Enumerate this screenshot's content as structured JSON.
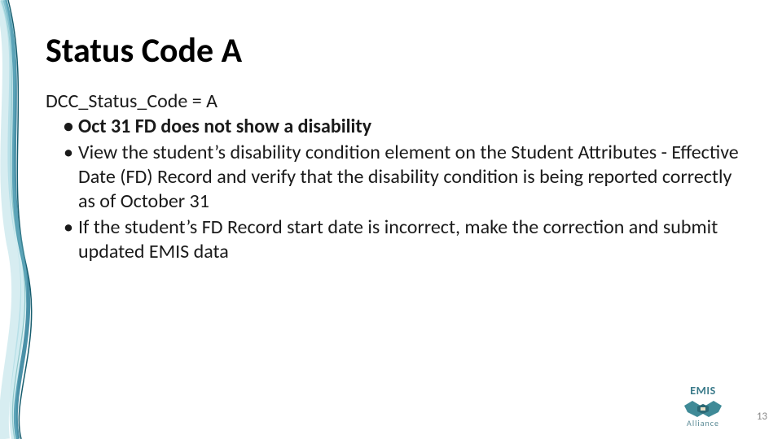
{
  "title": "Status Code A",
  "intro": "DCC_Status_Code = A",
  "bullets": [
    {
      "text": "Oct 31 FD does not show a disability",
      "bold": true
    },
    {
      "text": "View the student’s disability condition element on the Student Attributes - Effective Date (FD) Record and verify that the disability condition is being reported correctly as of October 31",
      "bold": false
    },
    {
      "text": "If the student’s FD Record start date is incorrect, make the correction and submit updated EMIS data",
      "bold": false
    }
  ],
  "logo": {
    "line1": "EMIS",
    "line2": "Alliance"
  },
  "page_number": "13"
}
